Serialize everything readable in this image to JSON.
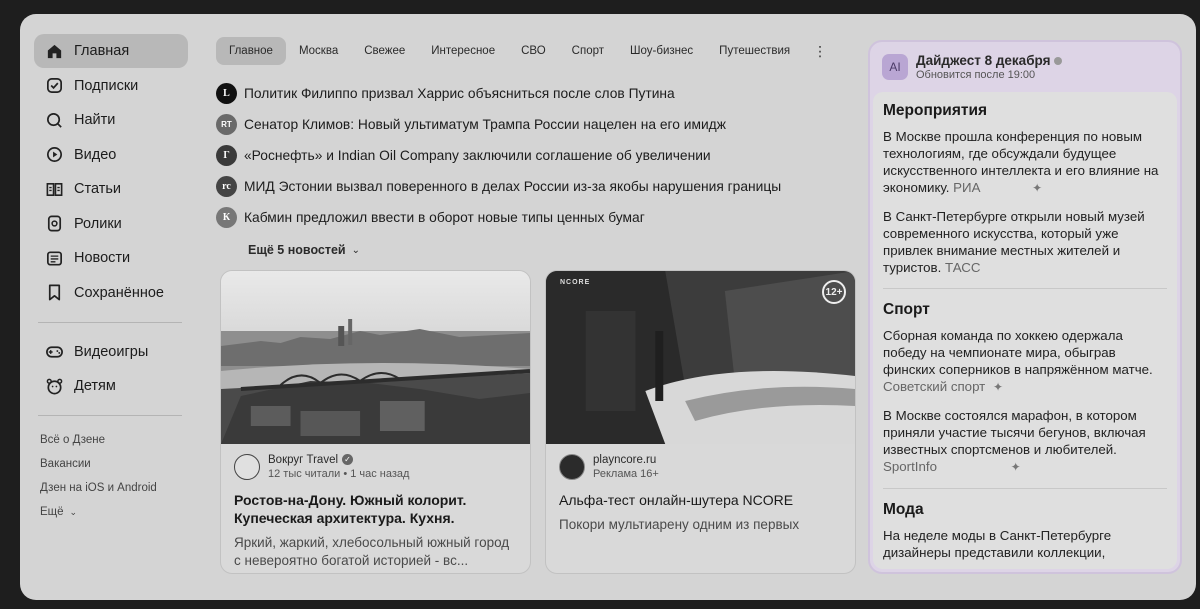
{
  "sidebar": {
    "items": [
      {
        "label": "Главная",
        "icon": "home-icon"
      },
      {
        "label": "Подписки",
        "icon": "subscriptions-icon"
      },
      {
        "label": "Найти",
        "icon": "search-icon"
      },
      {
        "label": "Видео",
        "icon": "video-icon"
      },
      {
        "label": "Статьи",
        "icon": "articles-icon"
      },
      {
        "label": "Ролики",
        "icon": "shorts-icon"
      },
      {
        "label": "Новости",
        "icon": "news-icon"
      },
      {
        "label": "Сохранённое",
        "icon": "bookmark-icon"
      }
    ],
    "items2": [
      {
        "label": "Видеоигры",
        "icon": "gamepad-icon"
      },
      {
        "label": "Детям",
        "icon": "kids-icon"
      }
    ],
    "footer": [
      "Всё о Дзене",
      "Вакансии",
      "Дзен на iOS и Android",
      "Ещё"
    ]
  },
  "tabs": [
    "Главное",
    "Москва",
    "Свежее",
    "Интересное",
    "СВО",
    "Спорт",
    "Шоу-бизнес",
    "Путешествия"
  ],
  "tabs_more": "⋮",
  "news": [
    {
      "logo": "L",
      "text": "Политик Филиппо призвал Харрис объясниться после слов Путина"
    },
    {
      "logo": "RT",
      "text": "Сенатор Климов: Новый ультиматум Трампа России нацелен на его имидж"
    },
    {
      "logo": "Г",
      "text": "«Роснефть» и Indian Oil Company заключили соглашение об увеличении"
    },
    {
      "logo": "rc",
      "text": "МИД Эстонии вызвал поверенного в делах России из-за якобы нарушения границы"
    },
    {
      "logo": "К",
      "text": "Кабмин предложил ввести в оборот новые типы ценных бумаг"
    }
  ],
  "more_news": "Ещё 5 новостей",
  "cards": [
    {
      "source": "Вокруг Travel",
      "meta": "12 тыс читали • 1 час назад",
      "title": "Ростов-на-Дону. Южный колорит. Купеческая архитектура. Кухня.",
      "desc": "Яркий, жаркий, хлебосольный южный город с невероятно богатой историей - вс..."
    },
    {
      "source": "playncore.ru",
      "meta": "Реклама 16+",
      "title": "Альфа-тест онлайн-шутера NCORE",
      "desc": "Покори мультиарену одним из первых",
      "image_logo": "NCORE",
      "age_badge": "12+"
    }
  ],
  "digest": {
    "ai_label": "AI",
    "title": "Дайджест 8 декабря",
    "subtitle": "Обновится после 19:00",
    "sections": [
      {
        "title": "Мероприятия",
        "items": [
          {
            "text": "В Москве прошла конференция по новым технологиям, где обсуждали будущее искусственного интеллекта и его влияние на экономику.",
            "source": "РИА"
          },
          {
            "text": "В Санкт-Петербурге открыли новый музей современного искусства, который уже привлек внимание местных жителей и туристов.",
            "source": "ТАСС"
          }
        ]
      },
      {
        "title": "Спорт",
        "items": [
          {
            "text": "Сборная команда по хоккею одержала победу на чемпионате мира, обыграв финских соперников в напряжённом матче.",
            "source": "Советский спорт"
          },
          {
            "text": "В Москве состоялся марафон, в котором приняли участие тысячи бегунов, включая известных спортсменов и любителей.",
            "source": "SportInfo"
          }
        ]
      },
      {
        "title": "Мода",
        "items": [
          {
            "text": "На неделе моды в Санкт-Петербурге дизайнеры представили коллекции,",
            "source": ""
          }
        ]
      }
    ]
  }
}
